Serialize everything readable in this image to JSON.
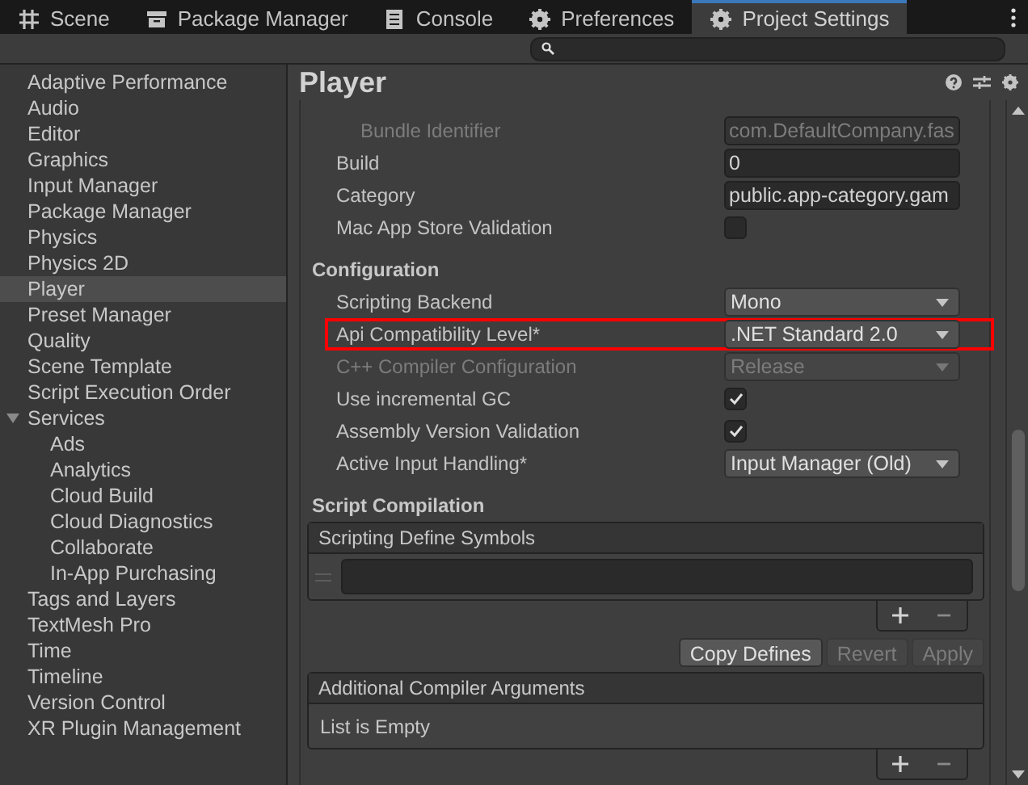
{
  "tabs": [
    {
      "label": "Scene",
      "kind": "grid",
      "selected": false
    },
    {
      "label": "Package Manager",
      "kind": "package",
      "selected": false
    },
    {
      "label": "Console",
      "kind": "console",
      "selected": false
    },
    {
      "label": "Preferences",
      "kind": "gear",
      "selected": false
    },
    {
      "label": "Project Settings",
      "kind": "gear",
      "selected": true
    }
  ],
  "sidebar": {
    "items": [
      {
        "label": "Adaptive Performance",
        "selected": false
      },
      {
        "label": "Audio",
        "selected": false
      },
      {
        "label": "Editor",
        "selected": false
      },
      {
        "label": "Graphics",
        "selected": false
      },
      {
        "label": "Input Manager",
        "selected": false
      },
      {
        "label": "Package Manager",
        "selected": false
      },
      {
        "label": "Physics",
        "selected": false
      },
      {
        "label": "Physics 2D",
        "selected": false
      },
      {
        "label": "Player",
        "selected": true
      },
      {
        "label": "Preset Manager",
        "selected": false
      },
      {
        "label": "Quality",
        "selected": false
      },
      {
        "label": "Scene Template",
        "selected": false
      },
      {
        "label": "Script Execution Order",
        "selected": false
      },
      {
        "label": "Services",
        "selected": false,
        "expanded": true,
        "children": [
          {
            "label": "Ads",
            "selected": false
          },
          {
            "label": "Analytics",
            "selected": false
          },
          {
            "label": "Cloud Build",
            "selected": false
          },
          {
            "label": "Cloud Diagnostics",
            "selected": false
          },
          {
            "label": "Collaborate",
            "selected": false
          },
          {
            "label": "In-App Purchasing",
            "selected": false
          }
        ]
      },
      {
        "label": "Tags and Layers",
        "selected": false
      },
      {
        "label": "TextMesh Pro",
        "selected": false
      },
      {
        "label": "Time",
        "selected": false
      },
      {
        "label": "Timeline",
        "selected": false
      },
      {
        "label": "Version Control",
        "selected": false
      },
      {
        "label": "XR Plugin Management",
        "selected": false
      }
    ]
  },
  "page": {
    "title": "Player",
    "rows": [
      {
        "kind": "text",
        "label": "Bundle Identifier",
        "value": "com.DefaultCompany.fas",
        "disabled": true,
        "indented": true
      },
      {
        "kind": "text",
        "label": "Build",
        "value": "0",
        "disabled": false
      },
      {
        "kind": "text",
        "label": "Category",
        "value": "public.app-category.gam",
        "disabled": false
      },
      {
        "kind": "checkbox",
        "label": "Mac App Store Validation",
        "checked": false
      },
      {
        "kind": "header",
        "label": "Configuration"
      },
      {
        "kind": "dropdown",
        "label": "Scripting Backend",
        "value": "Mono",
        "disabled": false
      },
      {
        "kind": "dropdown",
        "label": "Api Compatibility Level*",
        "value": ".NET Standard 2.0",
        "disabled": false,
        "highlighted": true
      },
      {
        "kind": "dropdown",
        "label": "C++ Compiler Configuration",
        "value": "Release",
        "disabled": true
      },
      {
        "kind": "checkbox",
        "label": "Use incremental GC",
        "checked": true
      },
      {
        "kind": "checkbox",
        "label": "Assembly Version Validation",
        "checked": true
      },
      {
        "kind": "dropdown",
        "label": "Active Input Handling*",
        "value": "Input Manager (Old)",
        "disabled": false
      },
      {
        "kind": "header",
        "label": "Script Compilation"
      }
    ],
    "define_symbols": {
      "title": "Scripting Define Symbols",
      "entries": [
        {
          "kind": "field"
        }
      ]
    },
    "define_buttons": [
      {
        "label": "Copy Defines",
        "disabled": false
      },
      {
        "label": "Revert",
        "disabled": true
      },
      {
        "label": "Apply",
        "disabled": true
      }
    ],
    "compiler_arguments": {
      "title": "Additional Compiler Arguments",
      "empty_text": "List is Empty"
    }
  }
}
